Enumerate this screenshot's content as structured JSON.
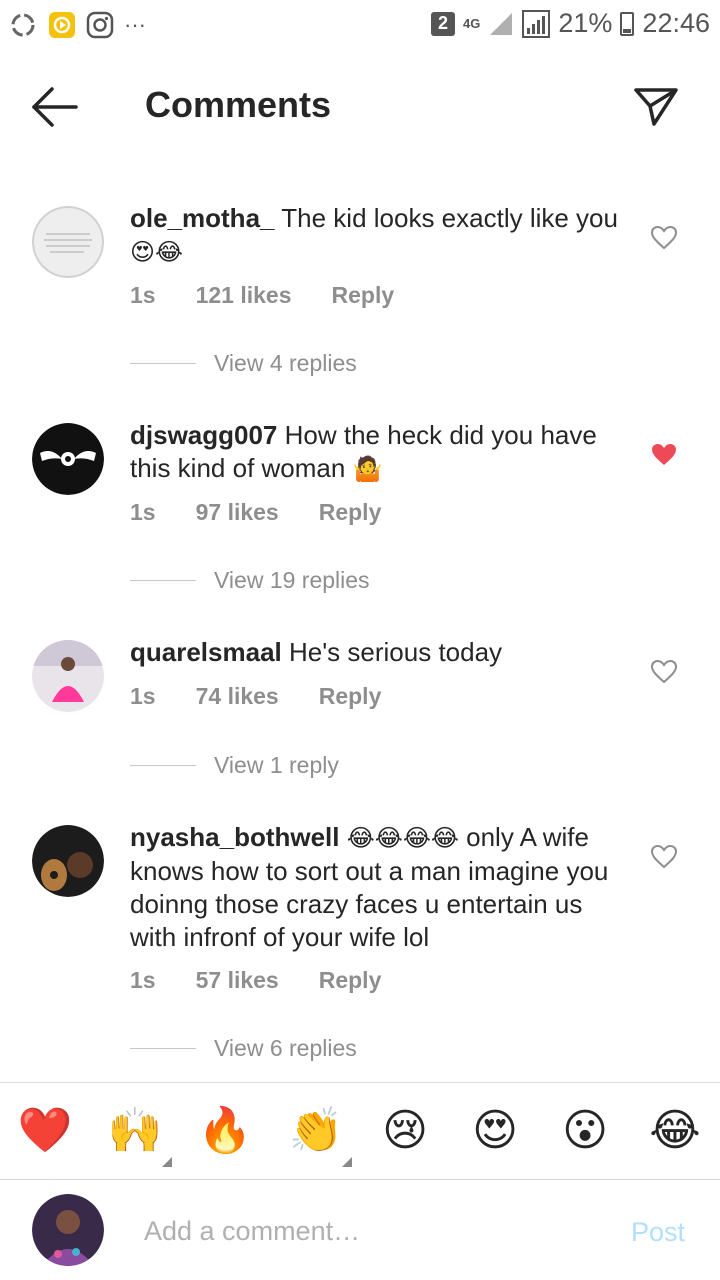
{
  "status_bar": {
    "sim": "2",
    "network": "4G",
    "battery": "21%",
    "time": "22:46",
    "dots": "···"
  },
  "header": {
    "title": "Comments"
  },
  "comments": [
    {
      "username": "ole_motha_",
      "text": "The kid looks exactly like you",
      "emojis": "😍😂",
      "time": "1s",
      "likes": "121 likes",
      "reply": "Reply",
      "liked": false,
      "view_replies": "View 4 replies"
    },
    {
      "username": "djswagg007",
      "text": "How the heck did you have this kind of woman",
      "emojis": "🤷",
      "time": "1s",
      "likes": "97 likes",
      "reply": "Reply",
      "liked": true,
      "view_replies": "View 19 replies"
    },
    {
      "username": "quarelsmaal",
      "text": "He's serious today",
      "emojis": "",
      "time": "1s",
      "likes": "74 likes",
      "reply": "Reply",
      "liked": false,
      "view_replies": "View 1 reply"
    },
    {
      "username": "nyasha_bothwell",
      "emojis": "😂😂😂😂",
      "text": "only A wife knows how to sort out a man imagine you doinng those crazy faces u entertain us with infronf of your wife lol",
      "time": "1s",
      "likes": "57 likes",
      "reply": "Reply",
      "liked": false,
      "view_replies": "View 6 replies"
    }
  ],
  "emoji_bar": [
    "❤️",
    "🙌",
    "🔥",
    "👏",
    "😢",
    "😍",
    "😮",
    "😂"
  ],
  "composer": {
    "placeholder": "Add a comment…",
    "post_label": "Post"
  },
  "colors": {
    "heart_liked": "#ed4956",
    "post_disabled": "#b2dffc",
    "secondary_text": "#8e8e8e"
  }
}
